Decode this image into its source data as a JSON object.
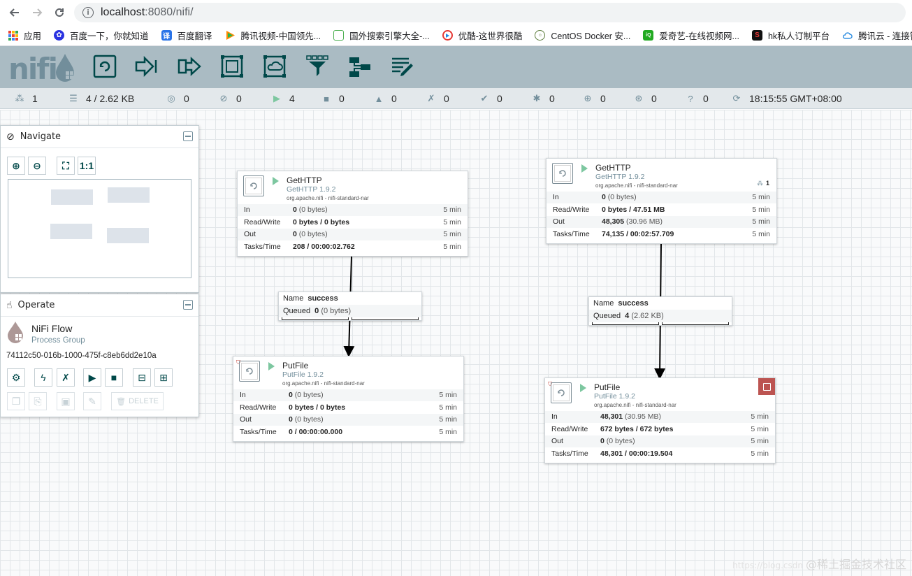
{
  "browser": {
    "url_host": "localhost",
    "url_path": ":8080/nifi/",
    "bookmarks": [
      {
        "label": "应用",
        "icon": "apps-grid-icon"
      },
      {
        "label": "百度一下，你就知道",
        "icon": "baidu-paw-icon",
        "color": "#2932e1"
      },
      {
        "label": "百度翻译",
        "icon": "baidu-translate-icon",
        "color": "#2a74e8"
      },
      {
        "label": "腾讯视频-中国领先...",
        "icon": "tencent-video-icon",
        "color": "#1db954"
      },
      {
        "label": "国外搜索引擎大全-...",
        "icon": "search-engine-icon",
        "color": "#4caf50"
      },
      {
        "label": "优酷-这世界很酷",
        "icon": "youku-icon",
        "color": "#e53935"
      },
      {
        "label": "CentOS Docker 安...",
        "icon": "centos-icon",
        "color": "#5c7c3b"
      },
      {
        "label": "爱奇艺-在线视频网...",
        "icon": "iqiyi-icon",
        "color": "#22aa22"
      },
      {
        "label": "hk私人订制平台",
        "icon": "hk-icon",
        "color": "#d32f2f"
      },
      {
        "label": "腾讯云 - 连接智能",
        "icon": "tencent-cloud-icon",
        "color": "#2b8ce0"
      }
    ]
  },
  "nifi": {
    "logo_text": "nifi",
    "status": {
      "transmitting": "1",
      "queued": "4 / 2.62 KB",
      "remote_transmitting": "0",
      "remote_not_transmitting": "0",
      "running": "4",
      "stopped": "0",
      "invalid": "0",
      "disabled": "0",
      "up_to_date": "0",
      "locally_modified": "0",
      "stale": "0",
      "modified_stale": "0",
      "sync_failure": "0",
      "refresh_time": "18:15:55 GMT+08:00"
    },
    "navigate": {
      "title": "Navigate"
    },
    "operate": {
      "title": "Operate",
      "group_name": "NiFi Flow",
      "group_type": "Process Group",
      "group_id": "74112c50-016b-1000-475f-c8eb6dd2e10a",
      "delete_label": "DELETE"
    },
    "processors": [
      {
        "name": "GetHTTP",
        "type": "GetHTTP 1.9.2",
        "bundle": "org.apache.nifi - nifi-standard-nar",
        "in_val": "0",
        "in_extra": "(0 bytes)",
        "rw_val": "0 bytes / 0 bytes",
        "rw_extra": "",
        "out_val": "0",
        "out_extra": "(0 bytes)",
        "tasks_val": "208 / 00:00:02.762",
        "window": "5 min",
        "badge": ""
      },
      {
        "name": "PutFile",
        "type": "PutFile 1.9.2",
        "bundle": "org.apache.nifi - nifi-standard-nar",
        "in_val": "0",
        "in_extra": "(0 bytes)",
        "rw_val": "0 bytes / 0 bytes",
        "rw_extra": "",
        "out_val": "0",
        "out_extra": "(0 bytes)",
        "tasks_val": "0 / 00:00:00.000",
        "window": "5 min",
        "badge": ""
      },
      {
        "name": "GetHTTP",
        "type": "GetHTTP 1.9.2",
        "bundle": "org.apache.nifi - nifi-standard-nar",
        "in_val": "0",
        "in_extra": "(0 bytes)",
        "rw_val": "0 bytes / 47.51 MB",
        "rw_extra": "",
        "out_val": "48,305",
        "out_extra": "(30.96 MB)",
        "tasks_val": "74,135 / 00:02:57.709",
        "window": "5 min",
        "badge": "1"
      },
      {
        "name": "PutFile",
        "type": "PutFile 1.9.2",
        "bundle": "org.apache.nifi - nifi-standard-nar",
        "in_val": "48,301",
        "in_extra": "(30.95 MB)",
        "rw_val": "672 bytes / 672 bytes",
        "rw_extra": "",
        "out_val": "0",
        "out_extra": "(0 bytes)",
        "tasks_val": "48,301 / 00:00:19.504",
        "window": "5 min",
        "badge": ""
      }
    ],
    "row_labels": {
      "in": "In",
      "rw": "Read/Write",
      "out": "Out",
      "tasks": "Tasks/Time"
    },
    "connections": [
      {
        "name_label": "Name",
        "name": "success",
        "queued_label": "Queued",
        "queued_count": "0",
        "queued_size": "(0 bytes)"
      },
      {
        "name_label": "Name",
        "name": "success",
        "queued_label": "Queued",
        "queued_count": "4",
        "queued_size": "(2.62 KB)"
      }
    ]
  },
  "watermark": {
    "prefix": "https://blog.csdn",
    "text": "@稀土掘金技术社区"
  }
}
